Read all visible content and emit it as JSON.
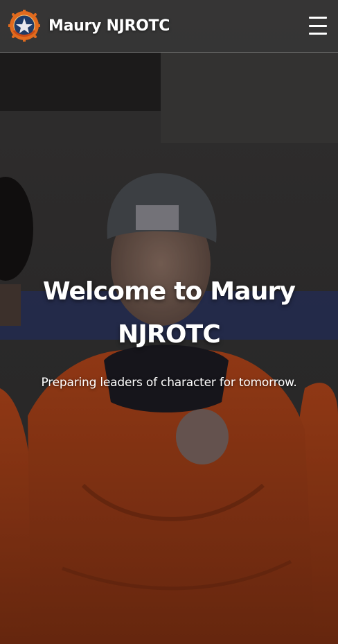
{
  "navbar": {
    "brand_name": "Maury NJROTC",
    "logo_icon": "njrotc-emblem-icon",
    "menu_icon": "hamburger-menu-icon"
  },
  "hero": {
    "title": "Welcome to Maury NJROTC",
    "subtitle": "Preparing leaders of character for tomorrow.",
    "background_image": "cadets-in-orange-jackets-photo"
  },
  "colors": {
    "navbar_bg": "#3c3c3c",
    "text": "#ffffff",
    "logo_ring": "#e06a1e",
    "logo_navy": "#1f3a66"
  }
}
